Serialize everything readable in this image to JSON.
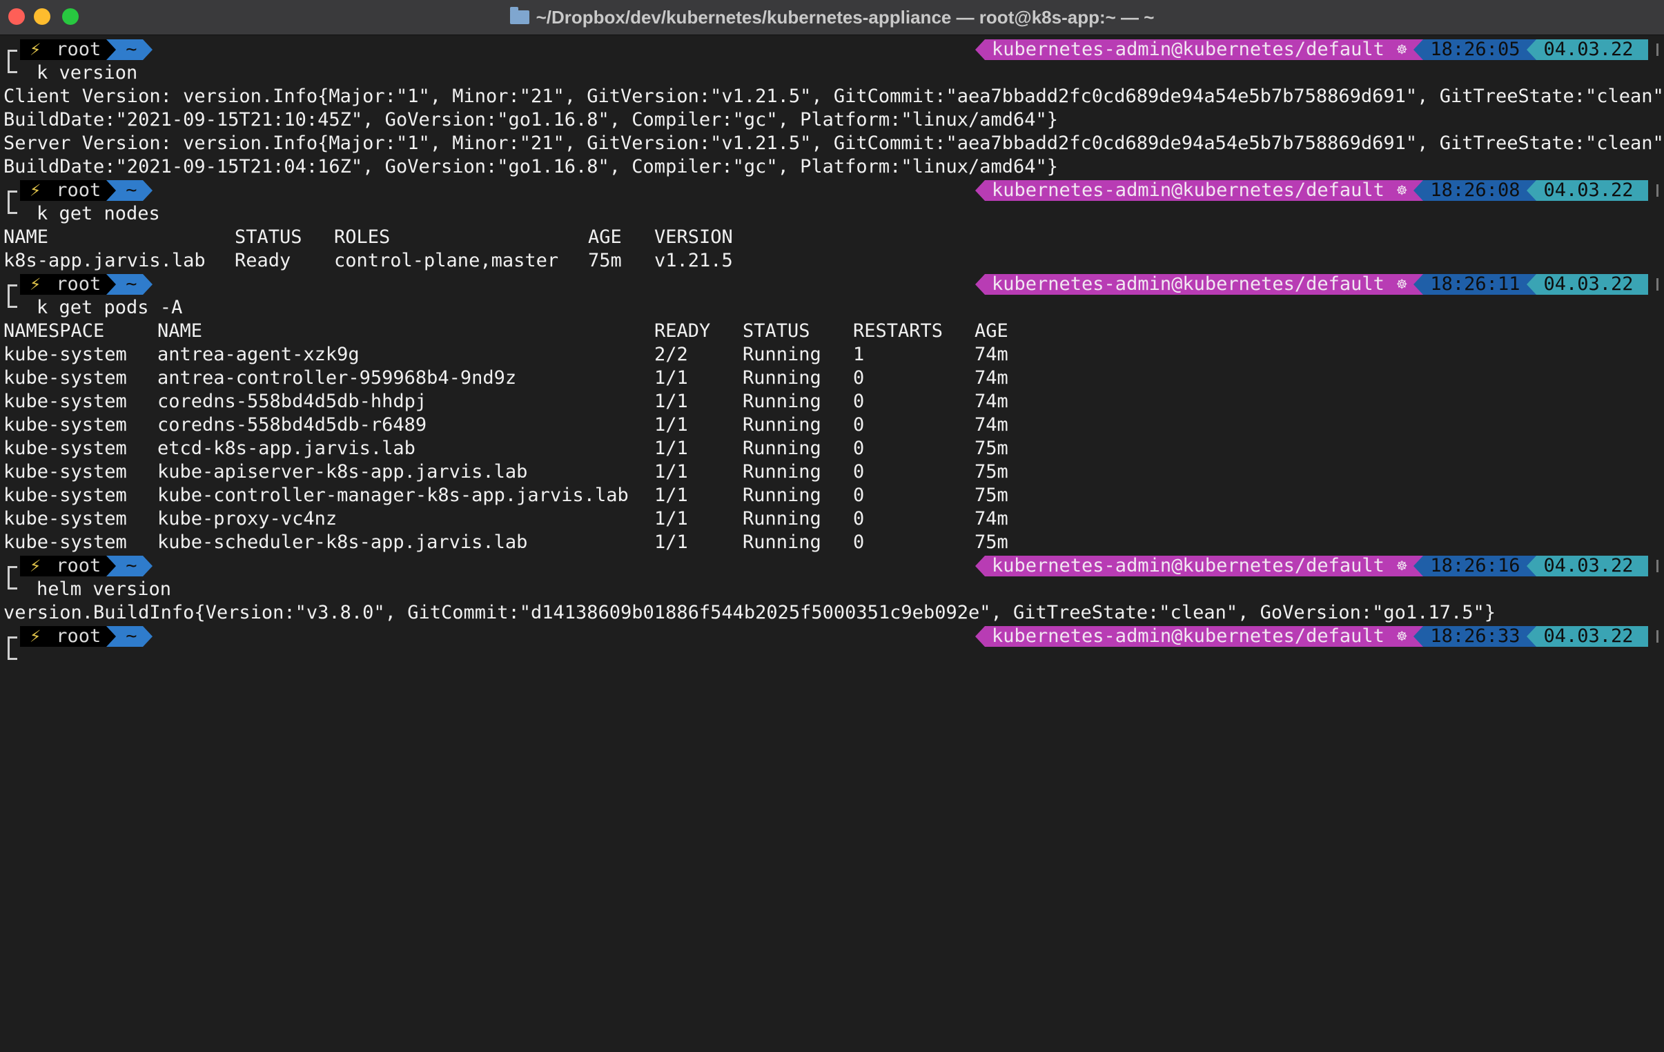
{
  "window": {
    "title": "~/Dropbox/dev/kubernetes/kubernetes-appliance — root@k8s-app:~ — ~"
  },
  "prompt": {
    "bolt_icon": "⚡",
    "user": "root",
    "dir": "~",
    "context": "kubernetes-admin@kubernetes/default",
    "k8s_icon": "☸",
    "colors": {
      "user_bg": "#000000",
      "dir_bg": "#2f7ccc",
      "context_bg": "#b83cb4",
      "time_bg": "#1f5fa8",
      "date_bg": "#3aa4b4"
    }
  },
  "prompts": [
    {
      "time": "18:26:05",
      "date": "04.03.22",
      "command": "k version"
    },
    {
      "time": "18:26:08",
      "date": "04.03.22",
      "command": "k get nodes"
    },
    {
      "time": "18:26:11",
      "date": "04.03.22",
      "command": "k get pods -A"
    },
    {
      "time": "18:26:16",
      "date": "04.03.22",
      "command": "helm version"
    },
    {
      "time": "18:26:33",
      "date": "04.03.22",
      "command": ""
    }
  ],
  "version_output": [
    "Client Version: version.Info{Major:\"1\", Minor:\"21\", GitVersion:\"v1.21.5\", GitCommit:\"aea7bbadd2fc0cd689de94a54e5b7b758869d691\", GitTreeState:\"clean\",",
    "BuildDate:\"2021-09-15T21:10:45Z\", GoVersion:\"go1.16.8\", Compiler:\"gc\", Platform:\"linux/amd64\"}",
    "Server Version: version.Info{Major:\"1\", Minor:\"21\", GitVersion:\"v1.21.5\", GitCommit:\"aea7bbadd2fc0cd689de94a54e5b7b758869d691\", GitTreeState:\"clean\",",
    "BuildDate:\"2021-09-15T21:04:16Z\", GoVersion:\"go1.16.8\", Compiler:\"gc\", Platform:\"linux/amd64\"}"
  ],
  "nodes_table": {
    "headers": [
      "NAME",
      "STATUS",
      "ROLES",
      "AGE",
      "VERSION"
    ],
    "rows": [
      [
        "k8s-app.jarvis.lab",
        "Ready",
        "control-plane,master",
        "75m",
        "v1.21.5"
      ]
    ]
  },
  "pods_table": {
    "headers": [
      "NAMESPACE",
      "NAME",
      "READY",
      "STATUS",
      "RESTARTS",
      "AGE"
    ],
    "rows": [
      [
        "kube-system",
        "antrea-agent-xzk9g",
        "2/2",
        "Running",
        "1",
        "74m"
      ],
      [
        "kube-system",
        "antrea-controller-959968b4-9nd9z",
        "1/1",
        "Running",
        "0",
        "74m"
      ],
      [
        "kube-system",
        "coredns-558bd4d5db-hhdpj",
        "1/1",
        "Running",
        "0",
        "74m"
      ],
      [
        "kube-system",
        "coredns-558bd4d5db-r6489",
        "1/1",
        "Running",
        "0",
        "74m"
      ],
      [
        "kube-system",
        "etcd-k8s-app.jarvis.lab",
        "1/1",
        "Running",
        "0",
        "75m"
      ],
      [
        "kube-system",
        "kube-apiserver-k8s-app.jarvis.lab",
        "1/1",
        "Running",
        "0",
        "75m"
      ],
      [
        "kube-system",
        "kube-controller-manager-k8s-app.jarvis.lab",
        "1/1",
        "Running",
        "0",
        "75m"
      ],
      [
        "kube-system",
        "kube-proxy-vc4nz",
        "1/1",
        "Running",
        "0",
        "74m"
      ],
      [
        "kube-system",
        "kube-scheduler-k8s-app.jarvis.lab",
        "1/1",
        "Running",
        "0",
        "75m"
      ]
    ]
  },
  "helm_output": "version.BuildInfo{Version:\"v3.8.0\", GitCommit:\"d14138609b01886f544b2025f5000351c9eb092e\", GitTreeState:\"clean\", GoVersion:\"go1.17.5\"}"
}
